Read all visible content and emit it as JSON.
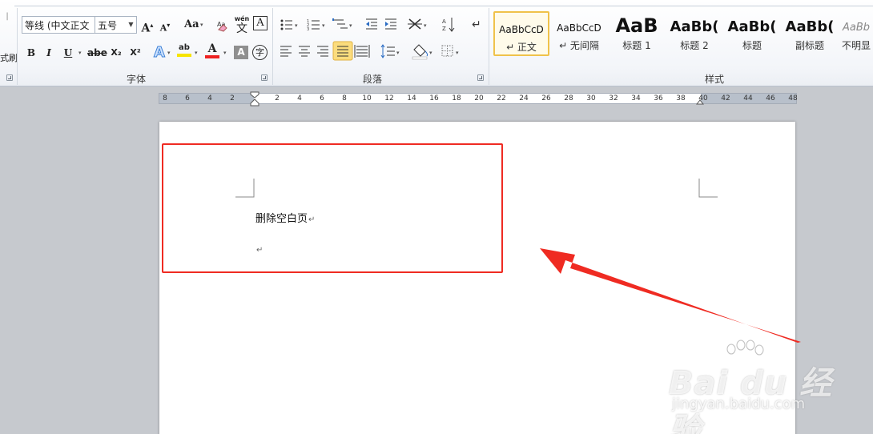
{
  "clipboard": {
    "format_painter_partial": "式刷",
    "edge_partial": "|"
  },
  "font_group": {
    "label": "字体",
    "font_name": "等线 (中文正文",
    "font_size": "五号",
    "grow": "A",
    "shrink": "A",
    "change_case": "Aa",
    "phonetic": "wén",
    "char_border": "A",
    "bold": "B",
    "italic": "I",
    "underline": "U",
    "strike": "abe",
    "subscript": "X₂",
    "superscript": "X²",
    "text_effect": "A",
    "highlight": "ab",
    "font_color": "A",
    "char_shading": "A",
    "enclose": "字"
  },
  "paragraph_group": {
    "label": "段落"
  },
  "styles_group": {
    "label": "样式",
    "tiles": [
      {
        "sample": "AaBbCcD",
        "name": "↵ 正文"
      },
      {
        "sample": "AaBbCcD",
        "name": "↵ 无间隔"
      },
      {
        "sample": "AaB",
        "name": "标题 1"
      },
      {
        "sample": "AaBb(",
        "name": "标题 2"
      },
      {
        "sample": "AaBb(",
        "name": "标题"
      },
      {
        "sample": "AaBb(",
        "name": "副标题"
      },
      {
        "sample": "AaBb",
        "name": "不明显"
      }
    ]
  },
  "ruler": {
    "labels": [
      "8",
      "6",
      "4",
      "2",
      "2",
      "4",
      "6",
      "8",
      "10",
      "12",
      "14",
      "16",
      "18",
      "20",
      "22",
      "24",
      "26",
      "28",
      "30",
      "32",
      "34",
      "36",
      "38",
      "40",
      "42",
      "44",
      "46",
      "48"
    ]
  },
  "document": {
    "line1": "删除空白页",
    "para_mark": "↵"
  },
  "watermark": {
    "logo": "Bai du 经验",
    "url": "jingyan.baidu.com"
  },
  "colors": {
    "annotation_red": "#ef2b22",
    "highlight_yellow": "#f7e400",
    "font_red": "#e22"
  }
}
